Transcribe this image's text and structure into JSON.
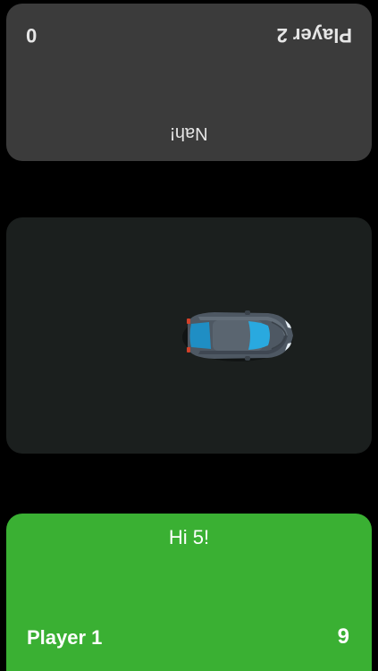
{
  "player2": {
    "name": "Player 2",
    "score": "0",
    "message": "Nah!",
    "panel_color": "#3b3b3b"
  },
  "arena": {
    "background": "#1b1f1e",
    "car_icon": "car-icon"
  },
  "player1": {
    "name": "Player 1",
    "score": "9",
    "message": "Hi 5!",
    "panel_color": "#3ab033"
  }
}
